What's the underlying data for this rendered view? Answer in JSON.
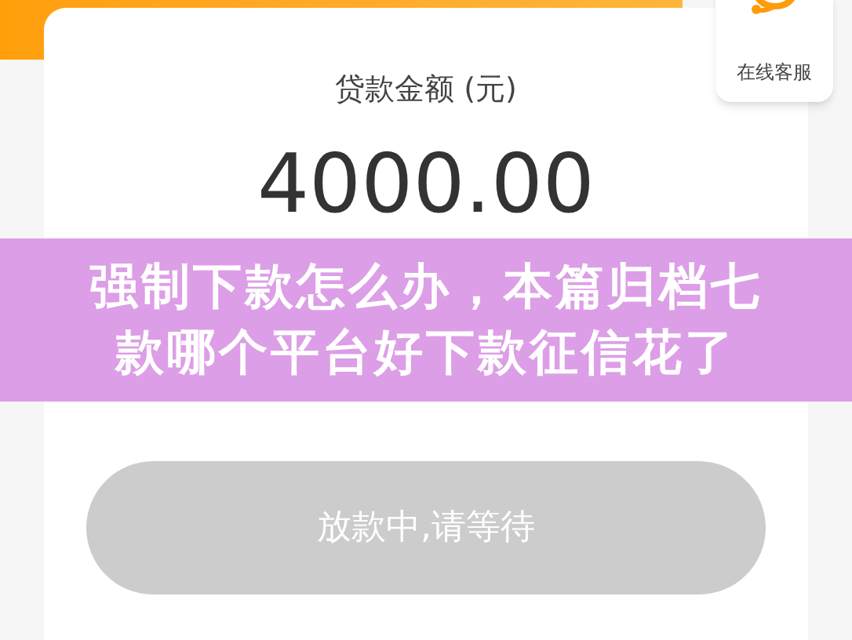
{
  "service": {
    "label": "在线客服"
  },
  "loan": {
    "label": "贷款金额 (元)",
    "amount": "4000.00"
  },
  "banner": {
    "title_lines": [
      "强制下款怎么办，本篇归档七",
      "款哪个平台好下款征信花了"
    ]
  },
  "submit": {
    "label": "放款中,请等待",
    "disabled": true
  }
}
